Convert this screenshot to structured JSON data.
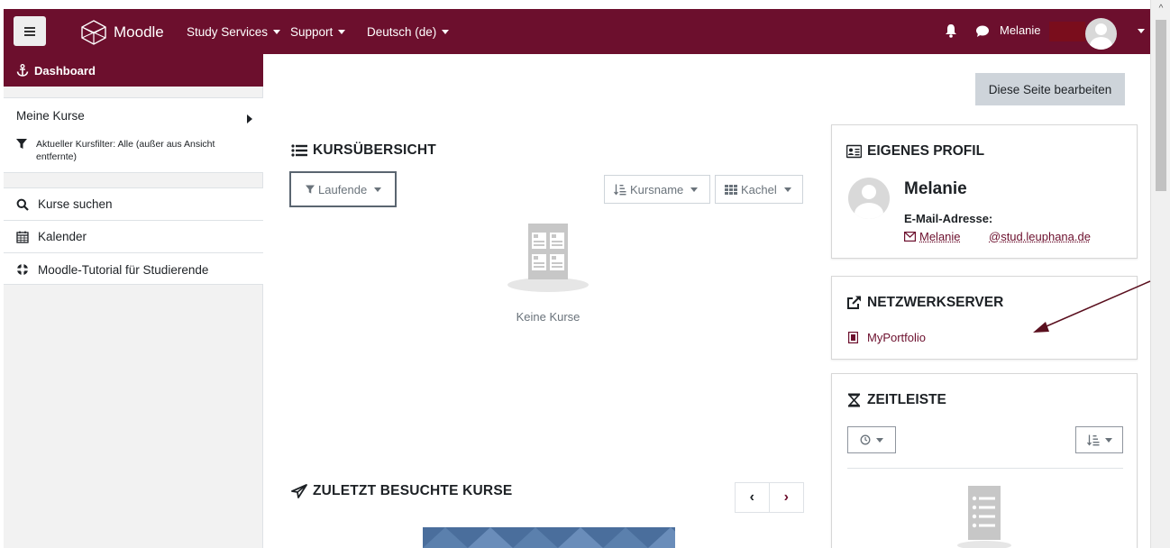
{
  "navbar": {
    "brand": "Moodle",
    "menu": [
      {
        "label": "Study Services"
      },
      {
        "label": "Support"
      },
      {
        "label": "Deutsch (de)"
      }
    ],
    "username": "Melanie",
    "accent_color": "#6c0f2d"
  },
  "drawer": {
    "header": "Dashboard",
    "my_courses": "Meine Kurse",
    "course_filter": "Aktueller Kursfilter: Alle (außer aus Ansicht entfernte)",
    "items": [
      {
        "label": "Kurse suchen",
        "icon": "search-icon"
      },
      {
        "label": "Kalender",
        "icon": "calendar-icon"
      },
      {
        "label": "Moodle-Tutorial für Studierende",
        "icon": "lifebuoy-icon"
      }
    ]
  },
  "main": {
    "edit_button": "Diese Seite bearbeiten",
    "course_overview": {
      "title": "KURSÜBERSICHT",
      "filter": "Laufende",
      "sort": "Kursname",
      "view": "Kachel",
      "empty": "Keine Kurse"
    },
    "recent": {
      "title": "ZULETZT BESUCHTE KURSE"
    }
  },
  "blocks": {
    "profile": {
      "title": "EIGENES PROFIL",
      "name": "Melanie",
      "email_label": "E-Mail-Adresse:",
      "email_user": "Melanie",
      "email_domain": "@stud.leuphana.de"
    },
    "network": {
      "title": "NETZWERKSERVER",
      "link": "MyPortfolio"
    },
    "timeline": {
      "title": "ZEITLEISTE"
    }
  }
}
